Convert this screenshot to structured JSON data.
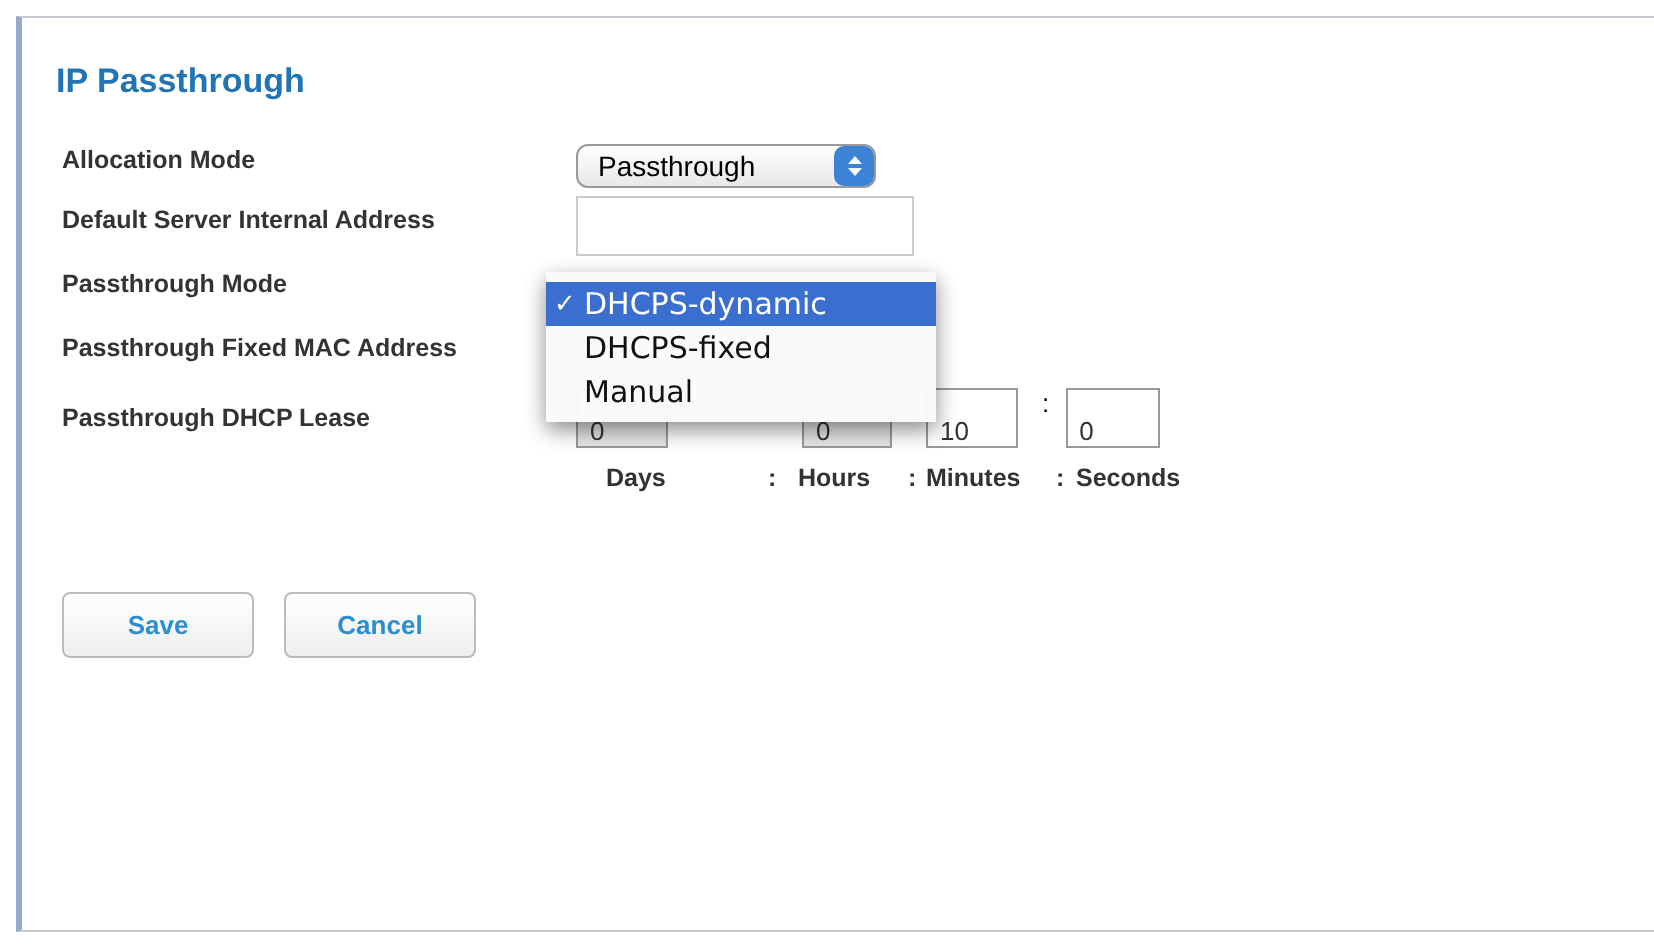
{
  "title": "IP Passthrough",
  "rows": [
    {
      "kind": "select",
      "label": "Allocation Mode",
      "value": "Passthrough"
    },
    {
      "kind": "text",
      "label": "Default Server Internal Address"
    },
    {
      "kind": "menu",
      "label": "Passthrough Mode",
      "check": "✓",
      "options": [
        {
          "label": "DHCPS-dynamic",
          "selected": true
        },
        {
          "label": "DHCPS-fixed",
          "selected": false
        },
        {
          "label": "Manual",
          "selected": false
        }
      ]
    },
    {
      "kind": "covered",
      "label": "Passthrough Fixed MAC Address"
    },
    {
      "kind": "lease",
      "label": "Passthrough DHCP Lease",
      "inputs": [
        {
          "value": "0"
        },
        {
          "value": "0"
        },
        {
          "value": "10"
        },
        {
          "value": "0",
          "separator": ":"
        }
      ],
      "units": [
        "Days",
        ":",
        "Hours",
        ":",
        "Minutes",
        ":",
        "Seconds"
      ]
    }
  ],
  "buttons": [
    "Save",
    "Cancel"
  ]
}
